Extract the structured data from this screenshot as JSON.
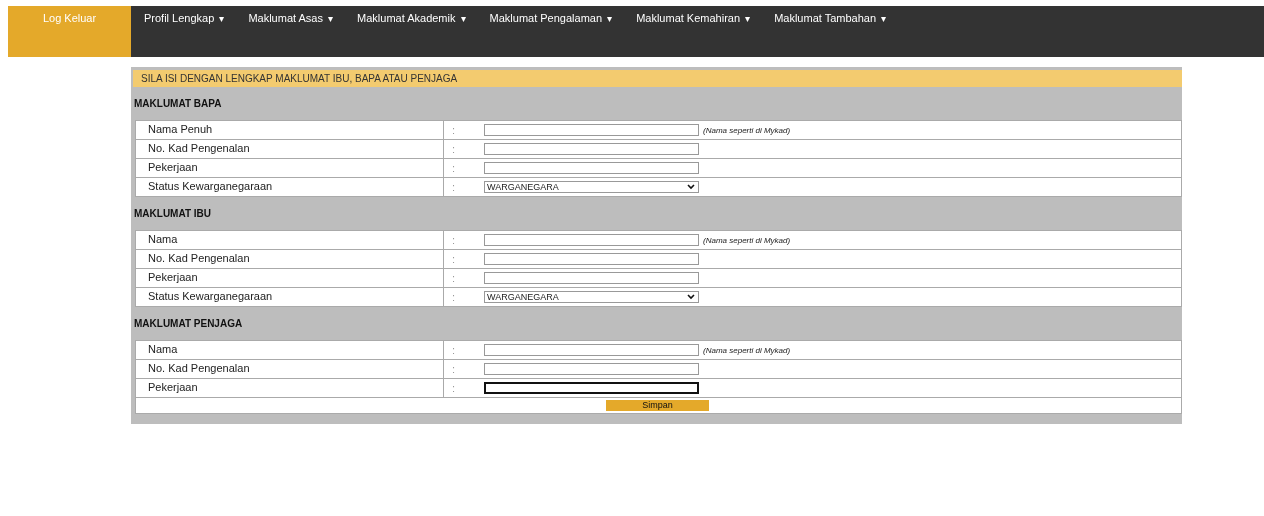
{
  "nav": {
    "logout": "Log Keluar",
    "menus": [
      {
        "label": "Profil Lengkap",
        "caret": "▾"
      },
      {
        "label": "Maklumat Asas",
        "caret": "▾"
      },
      {
        "label": "Maklumat Akademik",
        "caret": "▾"
      },
      {
        "label": "Maklumat Pengalaman",
        "caret": "▾"
      },
      {
        "label": "Maklumat Kemahiran",
        "caret": "▾"
      },
      {
        "label": "Maklumat Tambahan",
        "caret": "▾"
      }
    ]
  },
  "notice": "SILA ISI DENGAN LENGKAP MAKLUMAT IBU, BAPA ATAU PENJAGA",
  "sections": [
    {
      "title": "MAKLUMAT BAPA",
      "rows": [
        {
          "label": "Nama Penuh",
          "colon": ":",
          "kind": "text",
          "focused": false,
          "hint": "(Nama seperti di Mykad)"
        },
        {
          "label": "No. Kad Pengenalan",
          "colon": ":",
          "kind": "text",
          "focused": false
        },
        {
          "label": "Pekerjaan",
          "colon": ":",
          "kind": "text",
          "focused": false
        },
        {
          "label": "Status Kewarganegaraan",
          "colon": ":",
          "kind": "select",
          "value": "WARGANEGARA"
        }
      ]
    },
    {
      "title": "MAKLUMAT IBU",
      "rows": [
        {
          "label": "Nama",
          "colon": ":",
          "kind": "text",
          "focused": false,
          "hint": "(Nama seperti di Mykad)"
        },
        {
          "label": "No. Kad Pengenalan",
          "colon": ":",
          "kind": "text",
          "focused": false
        },
        {
          "label": "Pekerjaan",
          "colon": ":",
          "kind": "text",
          "focused": false
        },
        {
          "label": "Status Kewarganegaraan",
          "colon": ":",
          "kind": "select",
          "value": "WARGANEGARA"
        }
      ]
    },
    {
      "title": "MAKLUMAT PENJAGA",
      "rows": [
        {
          "label": "Nama",
          "colon": ":",
          "kind": "text",
          "focused": false,
          "hint": "(Nama seperti di Mykad)"
        },
        {
          "label": "No. Kad Pengenalan",
          "colon": ":",
          "kind": "text",
          "focused": false
        },
        {
          "label": "Pekerjaan",
          "colon": ":",
          "kind": "text",
          "focused": true
        }
      ]
    }
  ],
  "save_button": "Simpan"
}
